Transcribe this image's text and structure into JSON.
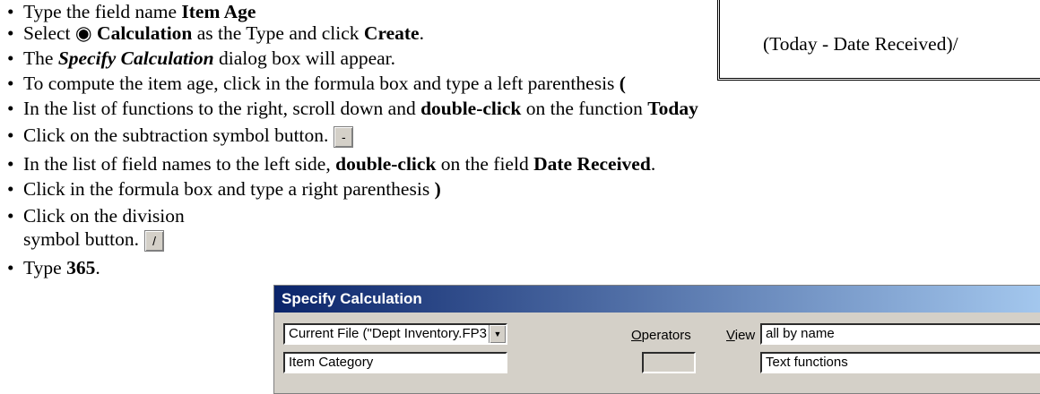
{
  "instructions": [
    {
      "pre": "Type the field name ",
      "bold": "Item Age",
      "post": ""
    },
    {
      "pre": "Select ",
      "bold": "◉ Calculation",
      "post": " as the Type and click ",
      "bold2": "Create",
      "post2": "."
    },
    {
      "pre": "The ",
      "bold": "Specify Calculation",
      "post": " dialog box will appear."
    },
    {
      "pre": "To compute the item age, click in the formula box and type a left parenthesis ",
      "bold": "(",
      "post": ""
    },
    {
      "pre": "In the list of functions to the right, scroll down and ",
      "bold": "double-click",
      "post": " on the function ",
      "bold2": "Today",
      "post2": ""
    },
    {
      "pre": "Click on the subtraction symbol button.",
      "button": "-"
    },
    {
      "pre": "In the list of field names to the left side, ",
      "bold": "double-click",
      "post": " on the field ",
      "bold2": "Date Received",
      "post2": "."
    },
    {
      "pre": "Click in the formula box and type a right parenthesis ",
      "bold": ")",
      "post": ""
    },
    {
      "pre": "Click on the division",
      "line2": "symbol button.",
      "button": "/"
    },
    {
      "pre": "Type ",
      "bold": "365",
      "post": "."
    }
  ],
  "callout": {
    "text": "(Today - Date Received)/"
  },
  "dialog": {
    "title": "Specify Calculation",
    "file_select": "Current File (\"Dept Inventory.FP3",
    "field_select": "Item Category",
    "operators_label": "Operators",
    "operators_u": "O",
    "operators_rest": "perators",
    "view_u": "V",
    "view_rest": "iew",
    "view_select": "all by name",
    "function_select": "Text functions"
  }
}
